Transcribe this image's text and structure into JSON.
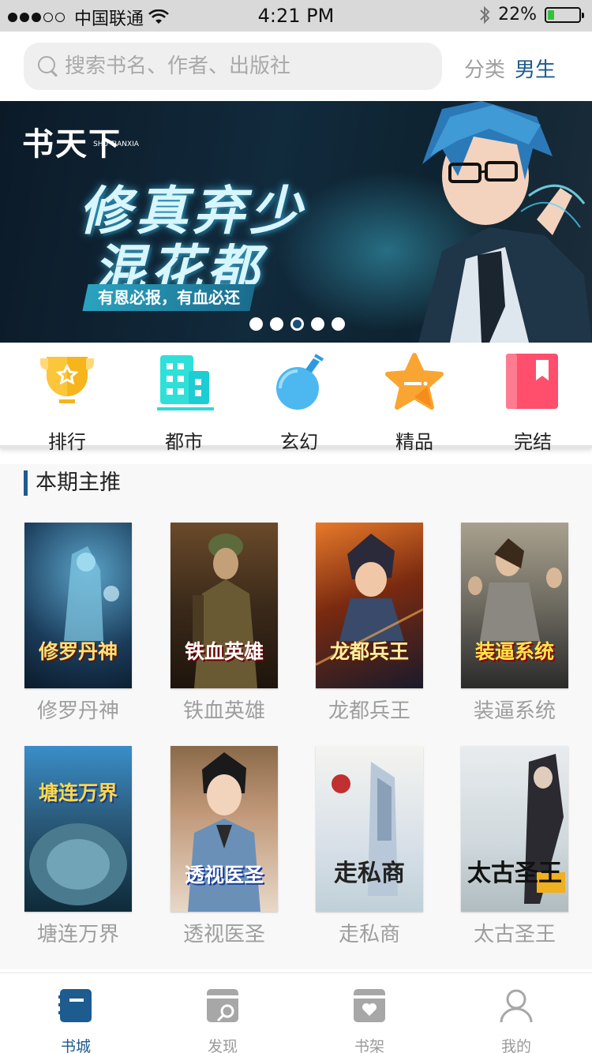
{
  "status_bar": {
    "carrier": "中国联通",
    "time": "4:21 PM",
    "battery": "22%",
    "battery_level": 0.22
  },
  "header": {
    "search_placeholder": "搜索书名、作者、出版社",
    "category_label": "分类",
    "gender_label": "男生"
  },
  "banner": {
    "logo": "书天下",
    "logo_sub": "SHU TIANXIA",
    "title_line1": "修真弃少",
    "title_line2": "混花都",
    "tagline": "有恩必报，有血必还",
    "page_count": 5,
    "active_page": 3
  },
  "shortcuts": [
    {
      "label": "排行",
      "icon": "trophy-icon"
    },
    {
      "label": "都市",
      "icon": "city-icon"
    },
    {
      "label": "玄幻",
      "icon": "gourd-icon"
    },
    {
      "label": "精品",
      "icon": "star-icon"
    },
    {
      "label": "完结",
      "icon": "bookmark-book-icon"
    }
  ],
  "featured": {
    "section_title": "本期主推",
    "books": [
      {
        "name": "修罗丹神",
        "cover_text": "修罗丹神"
      },
      {
        "name": "铁血英雄",
        "cover_text": "铁血英雄"
      },
      {
        "name": "龙都兵王",
        "cover_text": "龙都兵王"
      },
      {
        "name": "装逼系统",
        "cover_text": "装逼系统"
      },
      {
        "name": "塘连万界",
        "cover_text": "塘连万界"
      },
      {
        "name": "透视医圣",
        "cover_text": "透视医圣"
      },
      {
        "name": "走私商",
        "cover_text": "走私商"
      },
      {
        "name": "太古圣王",
        "cover_text": "太古圣王"
      }
    ]
  },
  "bottom_nav": [
    {
      "label": "书城",
      "icon": "bookstore-icon",
      "active": true
    },
    {
      "label": "发现",
      "icon": "discover-icon",
      "active": false
    },
    {
      "label": "书架",
      "icon": "bookshelf-icon",
      "active": false
    },
    {
      "label": "我的",
      "icon": "profile-icon",
      "active": false
    }
  ],
  "colors": {
    "accent": "#1e5b8e",
    "status_battery": "#34c13a"
  }
}
